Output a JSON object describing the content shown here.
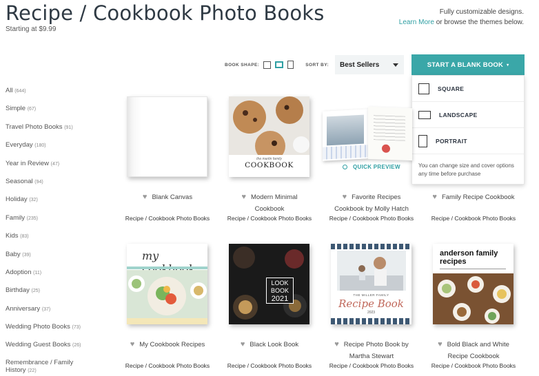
{
  "header": {
    "title": "Recipe / Cookbook Photo Books",
    "subtitle": "Starting at $9.99",
    "promo_line1": "Fully customizable designs.",
    "promo_link": "Learn More",
    "promo_line2": " or browse the themes below."
  },
  "controls": {
    "book_shape_label": "BOOK SHAPE:",
    "sort_label": "SORT BY:",
    "sort_value": "Best Sellers",
    "start_button": "START A BLANK BOOK",
    "start_caret": "▾"
  },
  "dropdown": {
    "items": [
      "SQUARE",
      "LANDSCAPE",
      "PORTRAIT"
    ],
    "note": "You can change size and cover options any time before purchase"
  },
  "sidebar": {
    "categories": [
      {
        "label": "All",
        "count": "(644)"
      },
      {
        "label": "Simple",
        "count": "(67)"
      },
      {
        "label": "Travel Photo Books",
        "count": "(91)"
      },
      {
        "label": "Everyday",
        "count": "(180)"
      },
      {
        "label": "Year in Review",
        "count": "(47)"
      },
      {
        "label": "Seasonal",
        "count": "(94)"
      },
      {
        "label": "Holiday",
        "count": "(32)"
      },
      {
        "label": "Family",
        "count": "(235)"
      },
      {
        "label": "Kids",
        "count": "(83)"
      },
      {
        "label": "Baby",
        "count": "(39)"
      },
      {
        "label": "Adoption",
        "count": "(11)"
      },
      {
        "label": "Birthday",
        "count": "(25)"
      },
      {
        "label": "Anniversary",
        "count": "(37)"
      },
      {
        "label": "Wedding Photo Books",
        "count": "(73)"
      },
      {
        "label": "Wedding Guest Books",
        "count": "(26)"
      },
      {
        "label": "Remembrance / Family History",
        "count": "(22)"
      }
    ]
  },
  "books": [
    {
      "title": "Blank Canvas",
      "category": "Recipe / Cookbook Photo Books"
    },
    {
      "title": "Modern Minimal Cookbook",
      "category": "Recipe / Cookbook Photo Books",
      "cover_small": "the martin family",
      "cover_big": "COOKBOOK"
    },
    {
      "title": "Favorite Recipes Cookbook by Molly Hatch",
      "category": "Recipe / Cookbook Photo Books",
      "quick_preview": "QUICK PREVIEW"
    },
    {
      "title": "Family Recipe Cookbook",
      "category": "Recipe / Cookbook Photo Books"
    },
    {
      "title": "My Cookbook Recipes",
      "category": "Recipe / Cookbook Photo Books",
      "cover_big": "my cookbook"
    },
    {
      "title": "Black Look Book",
      "category": "Recipe / Cookbook Photo Books",
      "cover_big": "LOOK BOOK",
      "cover_year": "2021"
    },
    {
      "title": "Recipe Photo Book by Martha Stewart",
      "category": "Recipe / Cookbook Photo Books",
      "cover_small": "THE MILLER FAMILY",
      "cover_big": "Recipe Book",
      "cover_year": "2023"
    },
    {
      "title": "Bold Black and White Recipe Cookbook",
      "category": "Recipe / Cookbook Photo Books",
      "cover_big": "anderson family recipes"
    }
  ],
  "colors": {
    "accent": "#3aa7a8",
    "heading": "#2f3a44"
  },
  "icons": [
    "heart-icon",
    "square-shape-icon",
    "landscape-shape-icon",
    "portrait-shape-icon",
    "search-icon",
    "chevron-down-icon"
  ]
}
